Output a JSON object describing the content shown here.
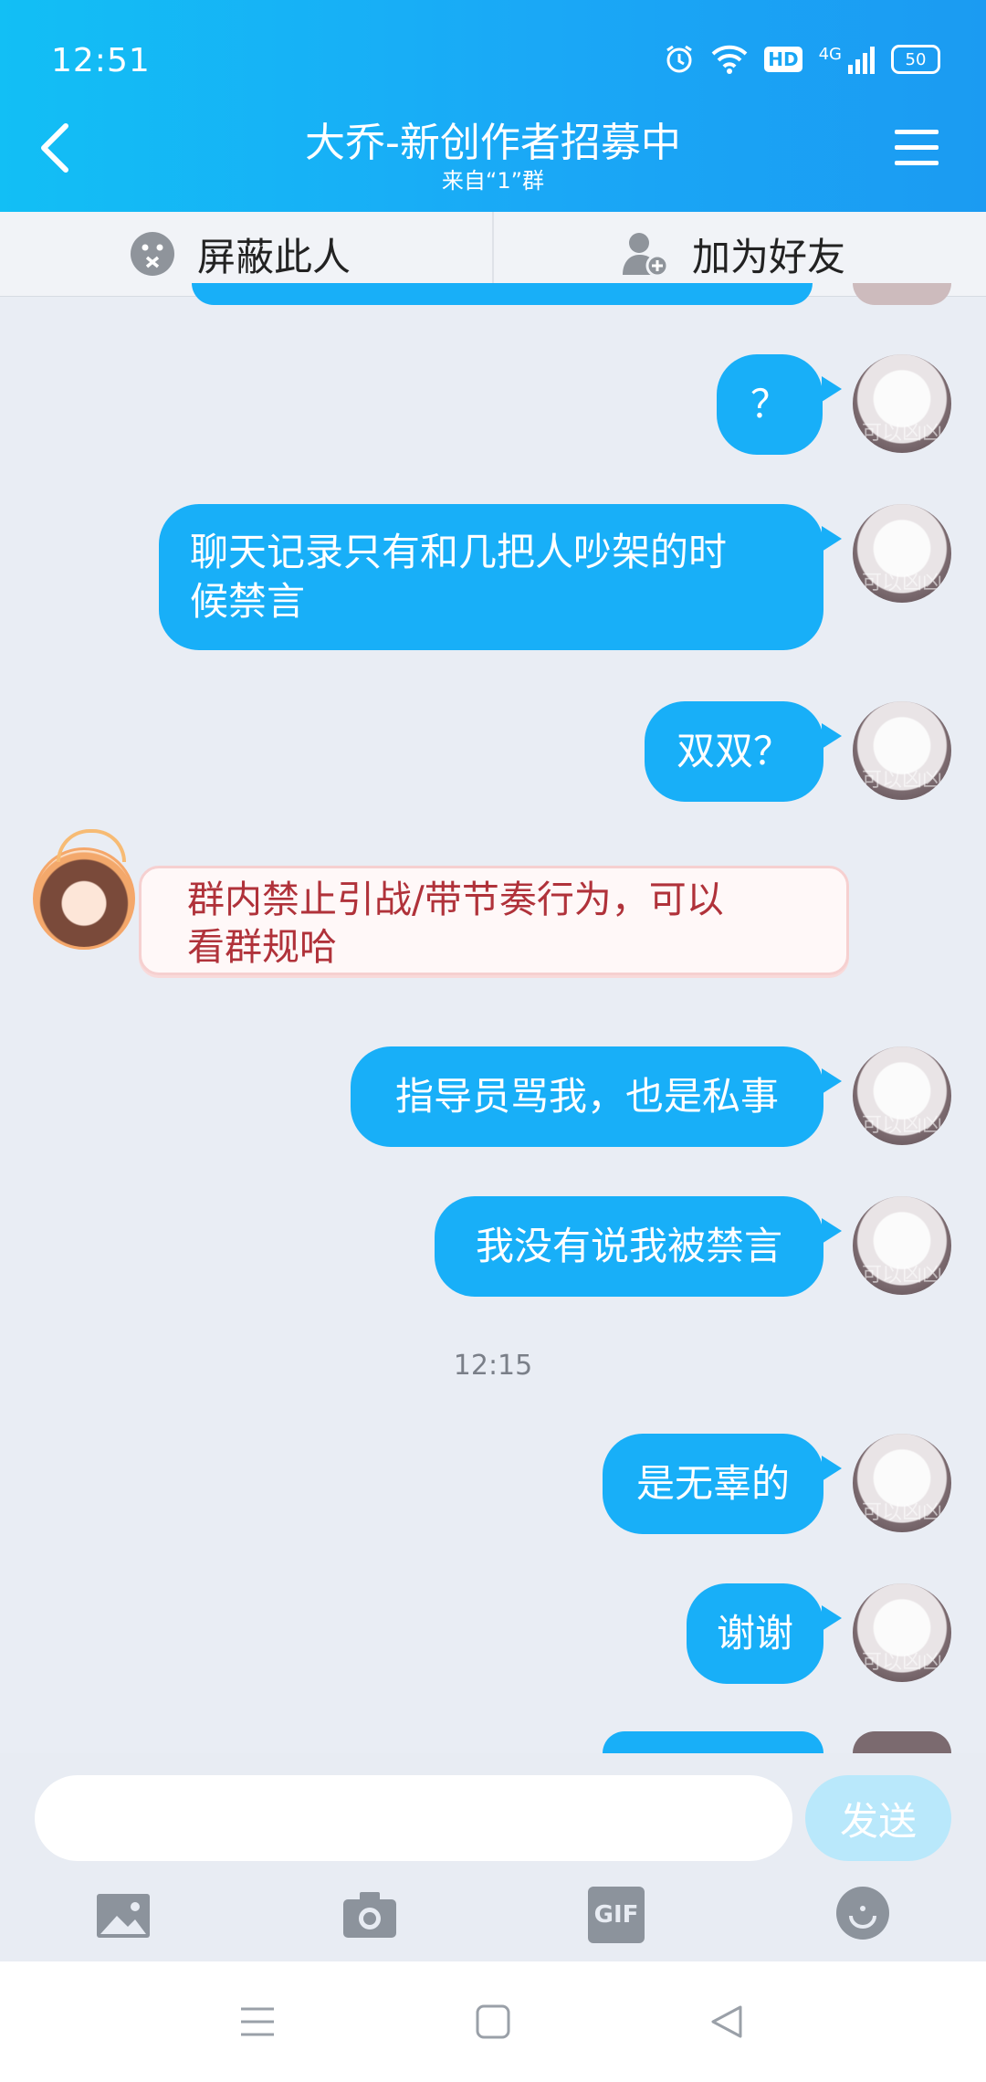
{
  "status_bar": {
    "time": "12:51",
    "battery": "50",
    "network": "4G",
    "hd": "HD"
  },
  "header": {
    "title": "大乔-新创作者招募中",
    "subtitle": "来自“1”群"
  },
  "actions": {
    "block_label": "屏蔽此人",
    "add_friend_label": "加为好友"
  },
  "messages": [
    {
      "text": "？"
    },
    {
      "text": "聊天记录只有和几把人吵架的时\n候禁言"
    },
    {
      "text": "双双？"
    },
    {
      "text": "群内禁止引战/带节奏行为，可以\n看群规哈"
    },
    {
      "text": "指导员骂我，也是私事"
    },
    {
      "text": "我没有说我被禁言"
    },
    {
      "text": "是无辜的"
    },
    {
      "text": "谢谢"
    }
  ],
  "timestamp": "12:15",
  "avatar_caption": "可以凶凶",
  "input": {
    "placeholder": "",
    "send_label": "发送"
  },
  "toolbar": {
    "gif_label": "GIF"
  },
  "colors": {
    "header": "#1aa8f6",
    "bubble": "#18aff8",
    "system_text": "#b0323a",
    "background": "#e9edf4"
  }
}
